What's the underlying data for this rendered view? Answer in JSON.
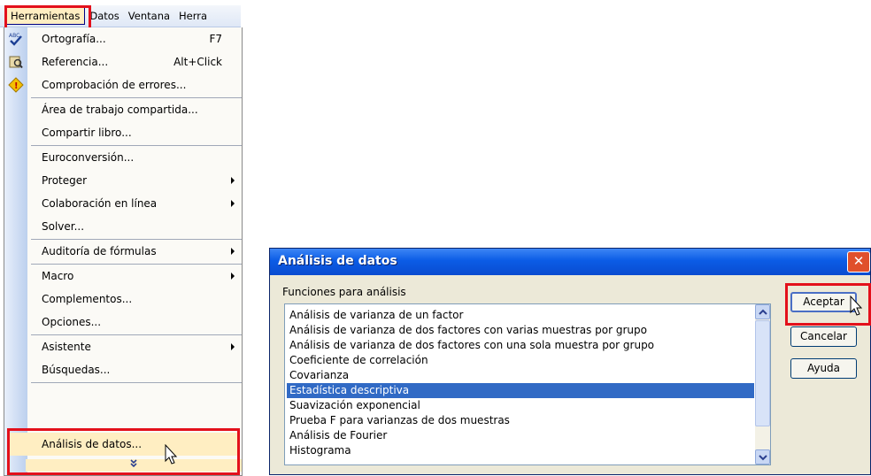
{
  "menubar": {
    "items": [
      "Herramientas",
      "Datos",
      "Ventana",
      "Herra"
    ]
  },
  "menu": {
    "items": [
      {
        "label": "Ortografía...",
        "shortcut": "F7",
        "icon": "spellcheck-icon"
      },
      {
        "label": "Referencia...",
        "shortcut": "Alt+Click",
        "icon": "research-icon"
      },
      {
        "label": "Comprobación de errores...",
        "icon": "error-check-icon"
      },
      {
        "label": "Área de trabajo compartida..."
      },
      {
        "label": "Compartir libro..."
      },
      {
        "label": "Euroconversión..."
      },
      {
        "label": "Proteger",
        "submenu": true
      },
      {
        "label": "Colaboración en línea",
        "submenu": true
      },
      {
        "label": "Solver..."
      },
      {
        "label": "Auditoría de fórmulas",
        "submenu": true
      },
      {
        "label": "Macro",
        "submenu": true
      },
      {
        "label": "Complementos..."
      },
      {
        "label": "Opciones..."
      },
      {
        "label": "Asistente",
        "submenu": true
      },
      {
        "label": "Búsquedas..."
      },
      {
        "label": "Análisis de datos...",
        "selected": true
      }
    ],
    "expand_icon": "chevron-double-down-icon"
  },
  "dialog": {
    "title": "Análisis de datos",
    "functions_label": "Funciones para análisis",
    "functions": [
      "Análisis de varianza de un factor",
      "Análisis de varianza de dos factores con varias muestras por grupo",
      "Análisis de varianza de dos factores con una sola muestra por grupo",
      "Coeficiente de correlación",
      "Covarianza",
      "Estadística descriptiva",
      "Suavización exponencial",
      "Prueba F para varianzas de dos muestras",
      "Análisis de Fourier",
      "Histograma"
    ],
    "selected_function": "Estadística descriptiva",
    "buttons": {
      "ok": "Aceptar",
      "cancel": "Cancelar",
      "help": "Ayuda"
    }
  },
  "colors": {
    "highlight": "#e3101b",
    "selection": "#316ac5",
    "menu_hover": "#ffeec2",
    "titlebar": "#0b5ce6"
  }
}
